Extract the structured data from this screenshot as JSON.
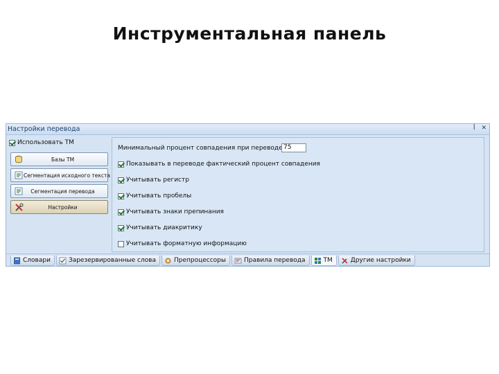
{
  "slide": {
    "title": "Инструментальная панель"
  },
  "panel": {
    "title": "Настройки перевода",
    "pin_glyph": "ꟾ",
    "close_glyph": "✕"
  },
  "left": {
    "use_tm_label": "Использовать TM",
    "use_tm_checked": true,
    "buttons": [
      {
        "label": "Базы ТМ",
        "icon": "database-icon"
      },
      {
        "label": "Сегментация исходного текста",
        "icon": "segmentation-icon"
      },
      {
        "label": "Сегментация перевода",
        "icon": "segmentation-icon"
      },
      {
        "label": "Настройки",
        "icon": "tools-icon"
      }
    ]
  },
  "options": {
    "min_percent_label": "Минимальный процент совпадения при переводе",
    "min_percent_value": "75",
    "items": [
      {
        "label": "Показывать в переводе фактический процент совпадения",
        "checked": true
      },
      {
        "label": "Учитывать регистр",
        "checked": true
      },
      {
        "label": "Учитывать пробелы",
        "checked": true
      },
      {
        "label": "Учитывать знаки препинания",
        "checked": true
      },
      {
        "label": "Учитывать диакритику",
        "checked": true
      },
      {
        "label": "Учитывать форматную информацию",
        "checked": false
      }
    ]
  },
  "tabs": [
    {
      "label": "Словари",
      "icon": "book-icon",
      "active": false
    },
    {
      "label": "Зарезервированные слова",
      "icon": "checklist-icon",
      "active": false
    },
    {
      "label": "Препроцессоры",
      "icon": "processor-icon",
      "active": false
    },
    {
      "label": "Правила перевода",
      "icon": "rules-icon",
      "active": false
    },
    {
      "label": "TM",
      "icon": "tm-icon",
      "active": true
    },
    {
      "label": "Другие настройки",
      "icon": "settings-icon",
      "active": false
    }
  ],
  "colors": {
    "panel_bg": "#d5e3f3",
    "check": "#1a7a2a"
  }
}
